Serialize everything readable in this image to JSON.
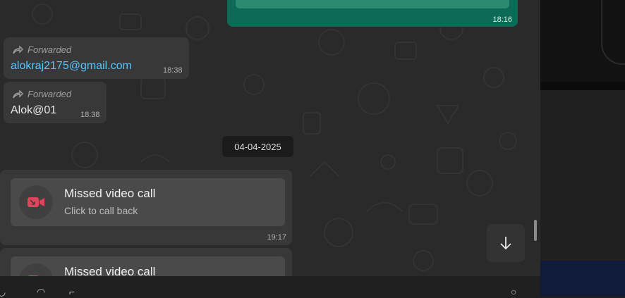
{
  "messages": {
    "outgoing_top": {
      "time": "18:16"
    },
    "forwarded_email": {
      "forwarded_label": "Forwarded",
      "text": "alokraj2175@gmail.com",
      "time": "18:38"
    },
    "forwarded_pass": {
      "forwarded_label": "Forwarded",
      "text": "Alok@01",
      "time": "18:38"
    }
  },
  "date_divider": "04-04-2025",
  "calls": [
    {
      "title": "Missed video call",
      "subtitle": "Click to call back",
      "time": "19:17"
    },
    {
      "title": "Missed video call"
    }
  ],
  "colors": {
    "outgoing_bubble": "#0b6b56",
    "incoming_bubble": "#383838",
    "link": "#58c4ff",
    "missed_call_icon": "#e0435a"
  },
  "icons": {
    "forward": "forward-arrow-icon",
    "missed_video_call": "missed-video-call-icon",
    "scroll_down": "arrow-down-icon"
  }
}
